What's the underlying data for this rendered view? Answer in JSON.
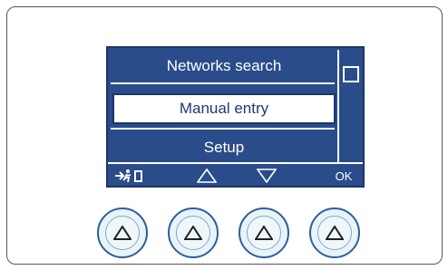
{
  "menu": {
    "items": [
      {
        "label": "Networks search"
      },
      {
        "label": "Manual entry"
      },
      {
        "label": "Setup"
      }
    ]
  },
  "softkeys": {
    "exit_icon": "exit-icon",
    "up_icon": "up-triangle-icon",
    "down_icon": "down-triangle-icon",
    "ok_label": "OK"
  },
  "buttons": {
    "icon": "up-triangle-icon"
  }
}
